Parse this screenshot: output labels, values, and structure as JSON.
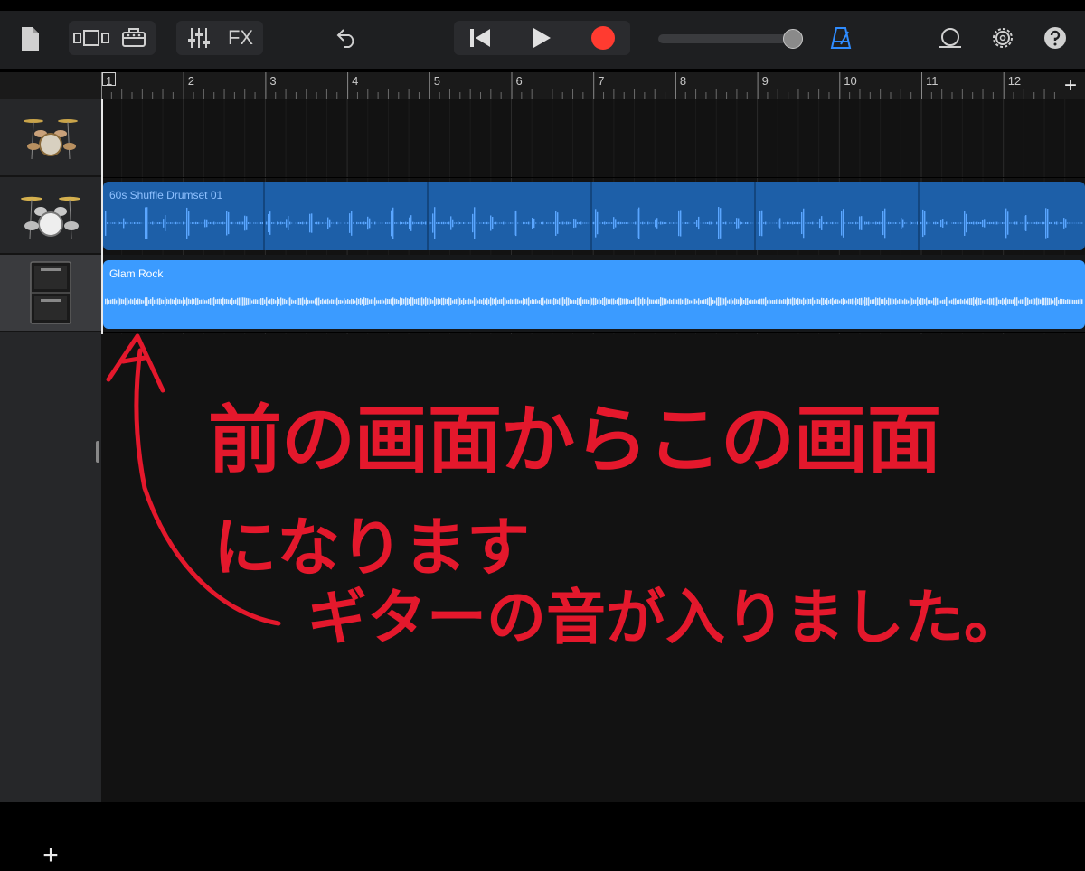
{
  "toolbar": {
    "fx_label": "FX"
  },
  "ruler": {
    "bars": [
      "1",
      "2",
      "3",
      "4",
      "5",
      "6",
      "7",
      "8",
      "9",
      "10",
      "11",
      "12"
    ]
  },
  "tracks": [
    {
      "instrument": "drum-kit",
      "region_title": ""
    },
    {
      "instrument": "drum-kit",
      "region_title": "60s Shuffle Drumset 01"
    },
    {
      "instrument": "guitar-amp",
      "region_title": "Glam Rock"
    }
  ],
  "annotation": {
    "line1": "前の画面からこの画面",
    "line2": "になります",
    "line3": "ギターの音が入りました。"
  },
  "colors": {
    "accent": "#2f8cff",
    "record": "#ff3b30",
    "drum_region": "#1d5fa8",
    "guitar_region": "#3b9bff",
    "handwriting": "#e4182c"
  }
}
